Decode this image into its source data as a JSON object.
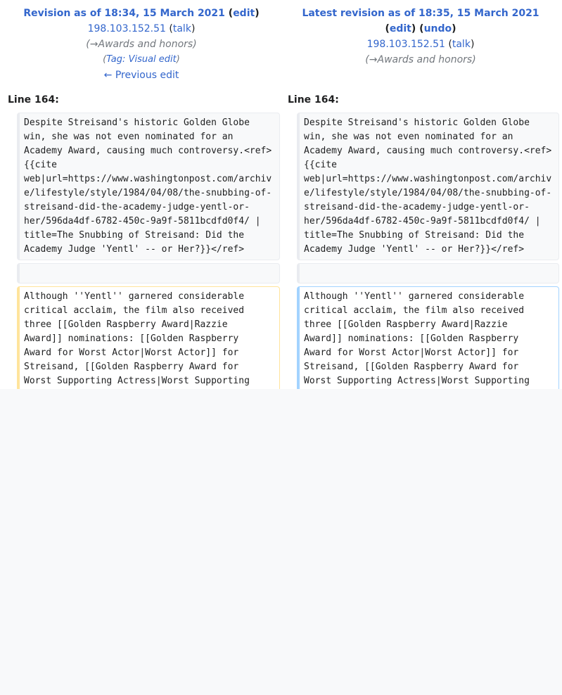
{
  "left": {
    "revision_label": "Revision as of 18:34, 15 March 2021",
    "edit_label": "edit",
    "user": "198.103.152.51",
    "talk_label": "talk",
    "summary": "→Awards and honors",
    "tag_prefix": "Tag:",
    "tag": "Visual edit",
    "previous_edit": "← Previous edit",
    "line_label": "Line 164:",
    "context_line": "Despite Streisand's historic Golden Globe\nwin, she was not even nominated for an\nAcademy Award, causing much controversy.<ref>\n{{cite\nweb|url=https://www.washingtonpost.com/archiv\ne/lifestyle/style/1984/04/08/the-snubbing-of-\nstreisand-did-the-academy-judge-yentl-or-\nher/596da4df-6782-450c-9a9f-5811bcdfd0f4/ |\ntitle=The Snubbing of Streisand: Did the\nAcademy Judge 'Yentl' -- or Her?}}</ref>",
    "changed_line": "Although ''Yentl'' garnered considerable\ncritical acclaim, the film also received\nthree [[Golden Raspberry Award|Razzie\nAward]] nominations: [[Golden Raspberry\nAward for Worst Actor|Worst Actor]] for\nStreisand, [[Golden Raspberry Award for\nWorst Supporting Actress|Worst Supporting"
  },
  "right": {
    "revision_label": "Latest revision as of 18:35, 15 March 2021",
    "edit_label": "edit",
    "undo_label": "undo",
    "user": "198.103.152.51",
    "talk_label": "talk",
    "summary": "→Awards and honors",
    "line_label": "Line 164:",
    "context_line": "Despite Streisand's historic Golden Globe\nwin, she was not even nominated for an\nAcademy Award, causing much controversy.<ref>\n{{cite\nweb|url=https://www.washingtonpost.com/archiv\ne/lifestyle/style/1984/04/08/the-snubbing-of-\nstreisand-did-the-academy-judge-yentl-or-\nher/596da4df-6782-450c-9a9f-5811bcdfd0f4/ |\ntitle=The Snubbing of Streisand: Did the\nAcademy Judge 'Yentl' -- or Her?}}</ref>",
    "changed_line": "Although ''Yentl'' garnered considerable\ncritical acclaim, the film also received\nthree [[Golden Raspberry Award|Razzie\nAward]] nominations: [[Golden Raspberry\nAward for Worst Actor|Worst Actor]] for\nStreisand, [[Golden Raspberry Award for\nWorst Supporting Actress|Worst Supporting"
  },
  "colors": {
    "link": "#3366cc",
    "deleted_border": "#ffe49c",
    "added_border": "#a3d3ff",
    "context_border": "#eaecf0"
  }
}
